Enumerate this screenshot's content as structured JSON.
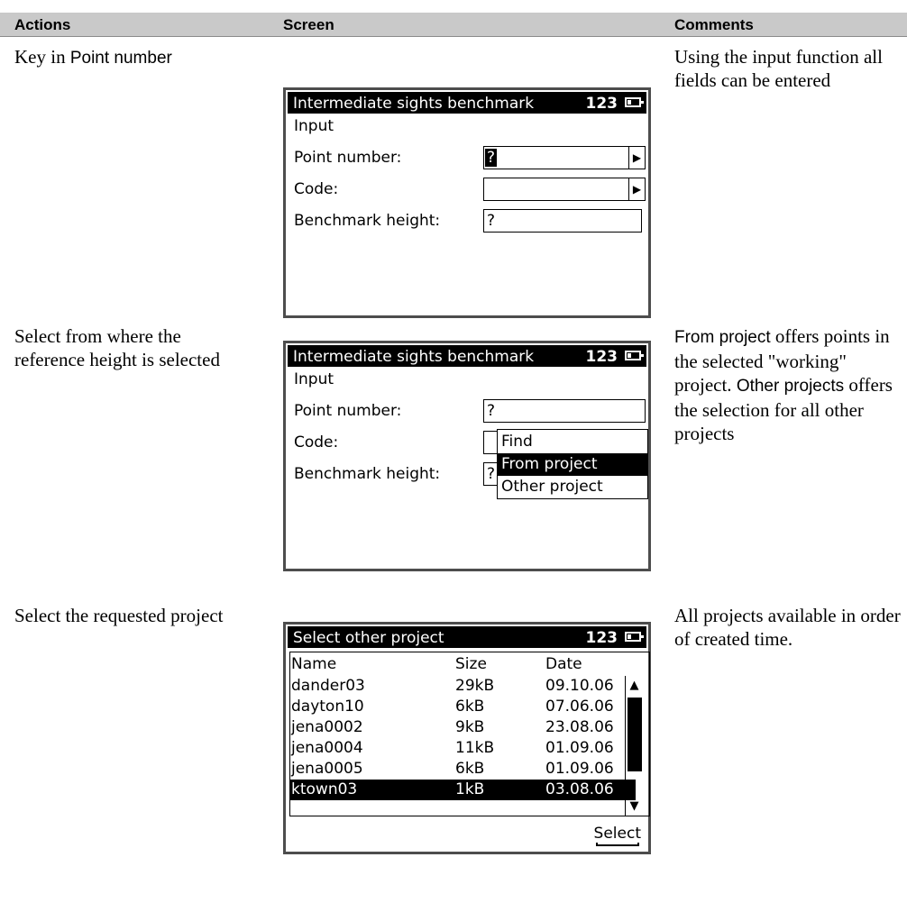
{
  "header": {
    "actions": "Actions",
    "screen": "Screen",
    "comments": "Comments"
  },
  "rows": [
    {
      "action_parts": [
        "Key in ",
        "Point number"
      ],
      "comment": "Using the input function all fields can be entered",
      "screen": {
        "title": "Intermediate sights benchmark",
        "mode": "123",
        "subtitle": "Input",
        "fields": [
          {
            "label": "Point number:",
            "value": "?"
          },
          {
            "label": "Code:",
            "value": ""
          },
          {
            "label": "Benchmark height:",
            "value": "?"
          }
        ]
      }
    },
    {
      "action": "Select from where the reference height is selected",
      "comment_parts": [
        "From project",
        " offers points in the selected \"working\" project. ",
        "Other projects",
        " offers the selection for all other projects"
      ],
      "screen": {
        "title": "Intermediate sights benchmark",
        "mode": "123",
        "subtitle": "Input",
        "fields": [
          {
            "label": "Point number:",
            "value": "?"
          },
          {
            "label": "Code:",
            "value": ""
          },
          {
            "label": "Benchmark height:",
            "value": "?"
          }
        ],
        "menu": [
          "Find",
          "From project",
          "Other project"
        ],
        "menu_selected": 1
      }
    },
    {
      "action": "Select the requested project",
      "comment": "All projects available in order of created time.",
      "screen": {
        "title": "Select other project",
        "mode": "123",
        "columns": [
          "Name",
          "Size",
          "Date"
        ],
        "projects": [
          {
            "name": "dander03",
            "size": "29kB",
            "date": "09.10.06"
          },
          {
            "name": "dayton10",
            "size": "6kB",
            "date": "07.06.06"
          },
          {
            "name": "jena0002",
            "size": "9kB",
            "date": "23.08.06"
          },
          {
            "name": "jena0004",
            "size": "11kB",
            "date": "01.09.06"
          },
          {
            "name": "jena0005",
            "size": "6kB",
            "date": "01.09.06"
          },
          {
            "name": "ktown03",
            "size": "1kB",
            "date": "03.08.06"
          }
        ],
        "selected_index": 5,
        "softkey": "Select"
      }
    }
  ]
}
